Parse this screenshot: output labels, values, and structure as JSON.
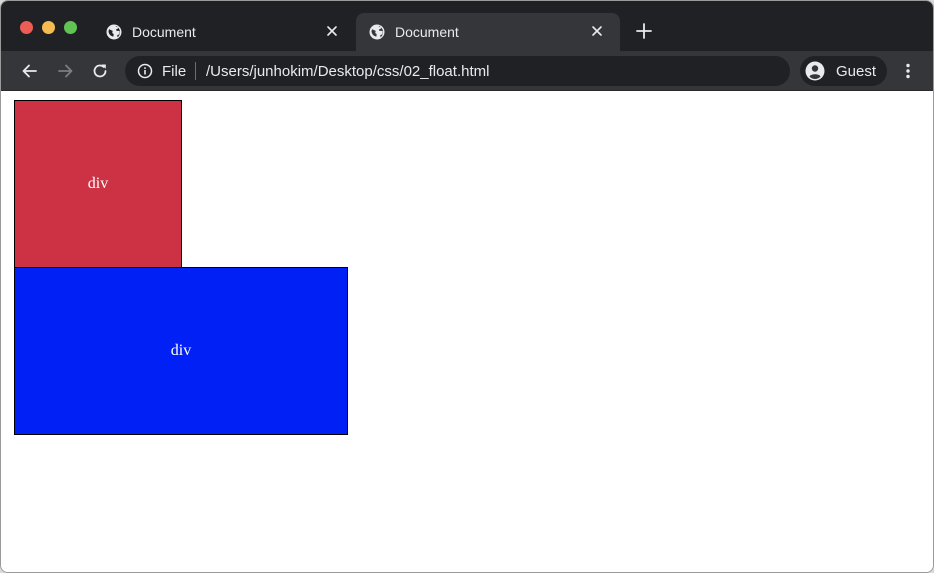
{
  "window": {
    "traffic_lights": [
      "close",
      "minimize",
      "zoom"
    ],
    "colors": {
      "close": "#ee5c56",
      "minimize": "#f5bd4f",
      "zoom": "#60c453"
    }
  },
  "tabs": [
    {
      "title": "Document",
      "icon": "globe-icon",
      "active": false
    },
    {
      "title": "Document",
      "icon": "globe-icon",
      "active": true
    }
  ],
  "toolbar": {
    "scheme_label": "File",
    "url": "/Users/junhokim/Desktop/css/02_float.html",
    "profile_label": "Guest"
  },
  "content": {
    "boxes": [
      {
        "label": "div",
        "color": "#cd3144"
      },
      {
        "label": "div",
        "color": "#0020f5"
      }
    ]
  }
}
